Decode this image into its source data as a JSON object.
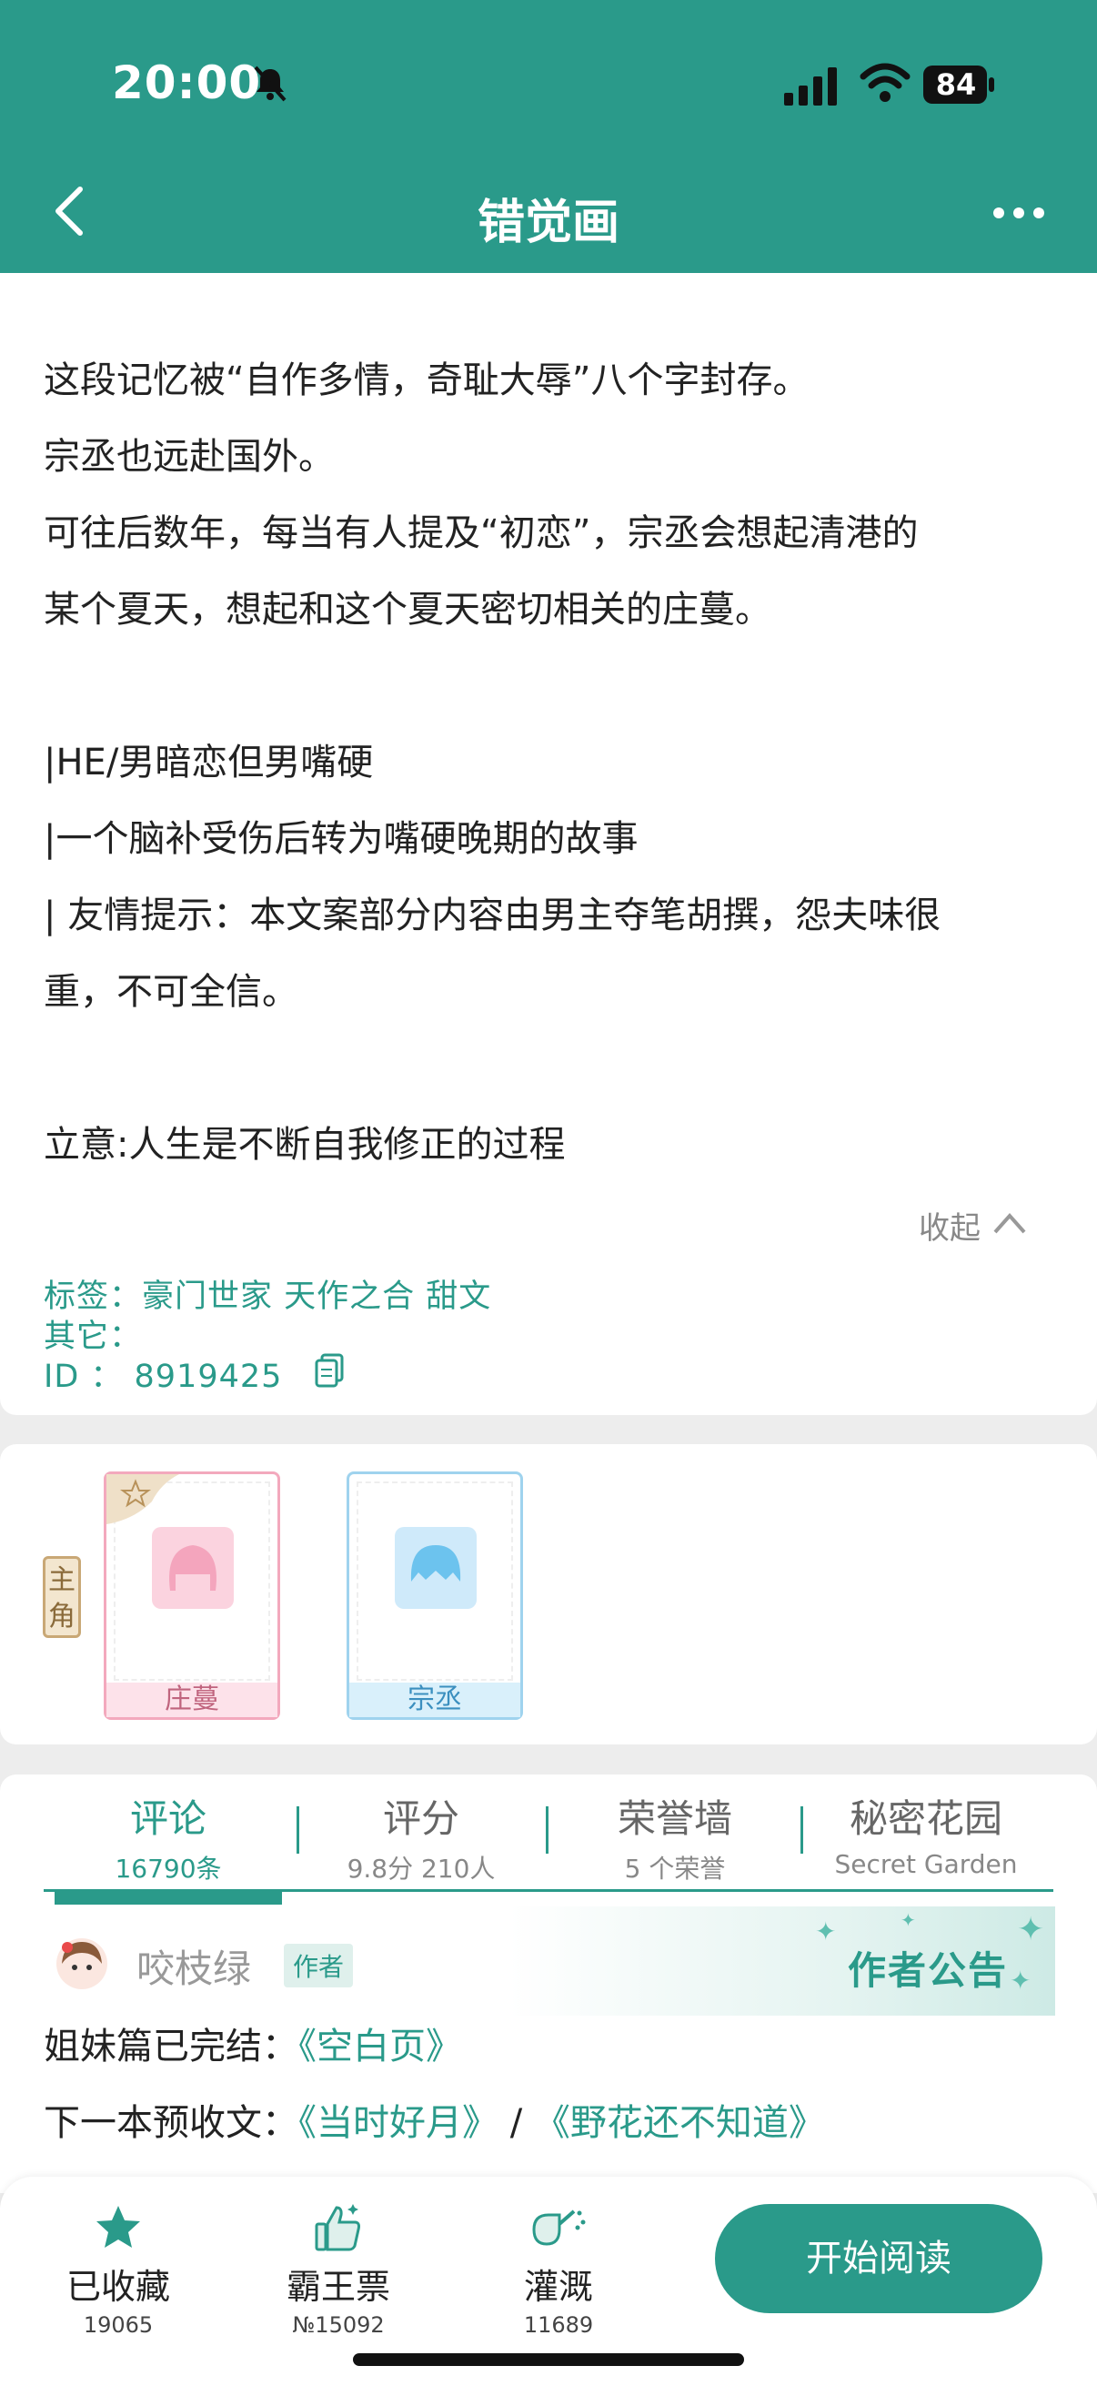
{
  "status_bar": {
    "time": "20:00",
    "battery": "84"
  },
  "header": {
    "title": "错觉画"
  },
  "intro": {
    "lines": [
      "这段记忆被“自作多情，奇耻大辱”八个字封存。",
      "宗丞也远赴国外。",
      "可往后数年，每当有人提及“初恋”，宗丞会想起清港的",
      "某个夏天，想起和这个夏天密切相关的庄蔓。",
      "|HE/男暗恋但男嘴硬",
      "|一个脑补受伤后转为嘴硬晚期的故事",
      "| 友情提示：本文案部分内容由男主夺笔胡撰，怨夫味很",
      "重，不可全信。",
      "立意:人生是不断自我修正的过程"
    ],
    "collapse_label": "收起"
  },
  "meta": {
    "tags": "标签：豪门世家  天作之合  甜文",
    "other": "其它：",
    "id": "ID   ：  8919425"
  },
  "characters": {
    "role_label": "主角",
    "items": [
      {
        "name": "庄蔓"
      },
      {
        "name": "宗丞"
      }
    ]
  },
  "tabs": [
    {
      "label": "评论",
      "sub": "16790条"
    },
    {
      "label": "评分",
      "sub": "9.8分 210人"
    },
    {
      "label": "荣誉墙",
      "sub": "5 个荣誉"
    },
    {
      "label": "秘密花园",
      "sub": "Secret Garden"
    }
  ],
  "notice": {
    "author": "咬枝绿",
    "badge": "作者",
    "title": "作者公告",
    "line1_prefix": "姐妹篇已完结：",
    "line1_link": "《空白页》",
    "line2_prefix": "下一本预收文：",
    "line2_link1": "《当时好月》",
    "line2_sep": "/",
    "line2_link2": "《野花还不知道》"
  },
  "bottom": {
    "actions": [
      {
        "label": "已收藏",
        "count": "19065",
        "icon": "star-icon"
      },
      {
        "label": "霸王票",
        "count": "№15092",
        "icon": "thumbs-up-icon"
      },
      {
        "label": "灌溉",
        "count": "11689",
        "icon": "watering-icon"
      }
    ],
    "read_button": "开始阅读"
  },
  "colors": {
    "accent": "#2a9a8a"
  }
}
